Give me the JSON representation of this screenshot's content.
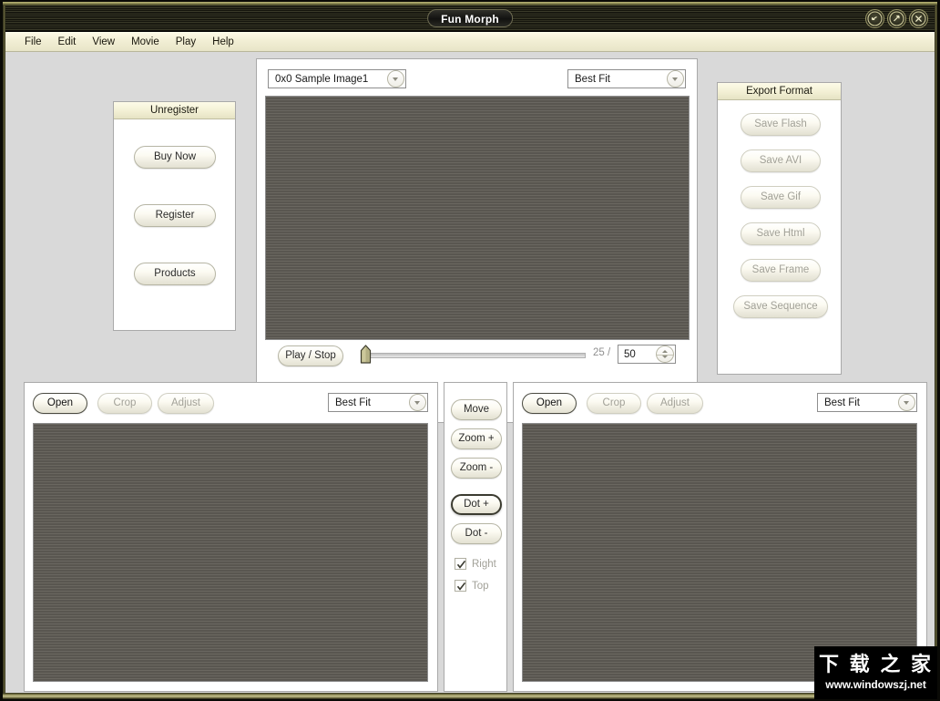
{
  "window": {
    "title": "Fun Morph",
    "buttons": [
      {
        "name": "minimize",
        "label": "Minimize"
      },
      {
        "name": "maximize",
        "label": "Maximize"
      },
      {
        "name": "close",
        "label": "Close"
      }
    ]
  },
  "menubar": {
    "items": [
      {
        "label": "File"
      },
      {
        "label": "Edit"
      },
      {
        "label": "View"
      },
      {
        "label": "Movie"
      },
      {
        "label": "Play"
      },
      {
        "label": "Help"
      }
    ]
  },
  "unregister": {
    "title": "Unregister",
    "buy_label": "Buy Now",
    "register_label": "Register",
    "products_label": "Products"
  },
  "movie": {
    "image_combo": {
      "value": "0x0 Sample Image1",
      "arrow_icon": "chevron-down-icon"
    },
    "fit_combo": {
      "value": "Best Fit",
      "arrow_icon": "chevron-down-icon"
    },
    "play_label": "Play / Stop",
    "frame_current": "25 /",
    "frame_total": "50",
    "slider_value": 0
  },
  "export": {
    "title": "Export Format",
    "buttons": [
      {
        "label": "Save Flash",
        "enabled": false
      },
      {
        "label": "Save AVI",
        "enabled": false
      },
      {
        "label": "Save Gif",
        "enabled": false
      },
      {
        "label": "Save Html",
        "enabled": false
      },
      {
        "label": "Save Frame",
        "enabled": false
      },
      {
        "label": "Save Sequence",
        "enabled": false
      }
    ]
  },
  "left_image": {
    "open_label": "Open",
    "crop_label": "Crop",
    "adjust_label": "Adjust",
    "fit_combo": {
      "value": "Best Fit",
      "arrow_icon": "chevron-down-icon"
    }
  },
  "right_image": {
    "open_label": "Open",
    "crop_label": "Crop",
    "adjust_label": "Adjust",
    "fit_combo": {
      "value": "Best Fit",
      "arrow_icon": "chevron-down-icon"
    }
  },
  "toolbox": {
    "move_label": "Move",
    "zoom_in_label": "Zoom +",
    "zoom_out_label": "Zoom -",
    "dot_add_label": "Dot +",
    "dot_del_label": "Dot -",
    "right_label": "Right",
    "top_label": "Top",
    "right_checked": true,
    "top_checked": true
  },
  "watermark": {
    "cn_text": "下  载  之  家",
    "url": "www.windowszj.net"
  },
  "colors": {
    "frame": "#6d6a40",
    "titlebar": "#14140c",
    "panel_bg": "#ffffff",
    "desktop_bg": "#d9d9d9",
    "group_title": "#f4f1d6",
    "canvas": "#636059",
    "accent": "#b8b47a"
  }
}
